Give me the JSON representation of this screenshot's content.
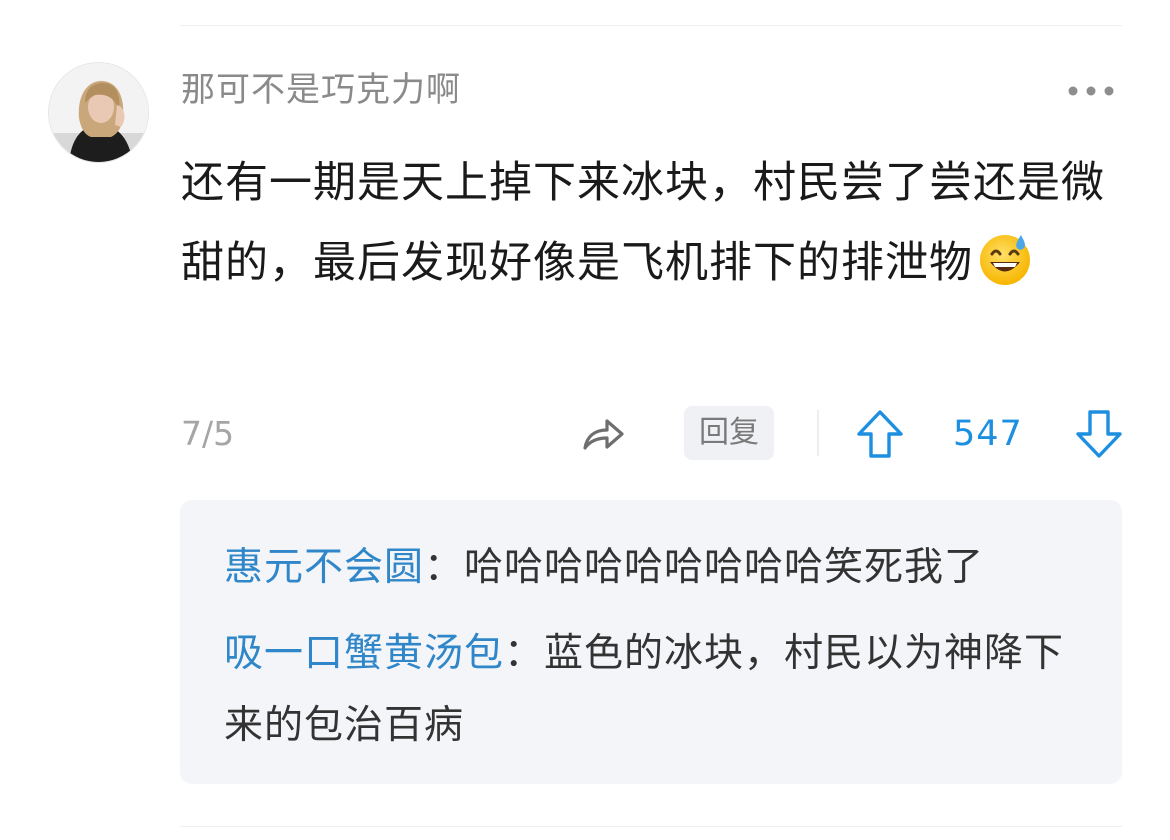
{
  "comment": {
    "username": "那可不是巧克力啊",
    "text": "还有一期是天上掉下来冰块，村民尝了尝还是微甜的，最后发现好像是飞机排下的排泄物",
    "date": "7/5",
    "reply_label": "回复",
    "vote_count": "547"
  },
  "replies": [
    {
      "author": "惠元不会圆",
      "separator": "：",
      "text": "哈哈哈哈哈哈哈哈哈笑死我了"
    },
    {
      "author": "吸一口蟹黄汤包",
      "separator": "：",
      "text": "蓝色的冰块，村民以为神降下来的包治百病"
    }
  ],
  "icons": {
    "more": "more-dots-icon",
    "share": "share-arrow-icon",
    "upvote": "arrow-up-icon",
    "downvote": "arrow-down-icon",
    "emoji": "grinning-sweat-emoji"
  },
  "colors": {
    "accent": "#1d8fe1",
    "reply_author": "#2f86c8",
    "muted": "#8a8a8a",
    "reply_bg": "#f4f5f9"
  }
}
